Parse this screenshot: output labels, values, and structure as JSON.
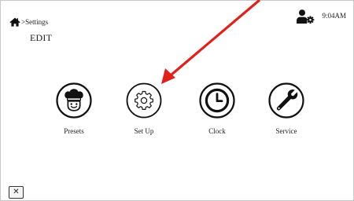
{
  "header": {
    "breadcrumb": ">Settings",
    "title": "EDIT",
    "time": "9:04AM"
  },
  "icons": {
    "home": "home-icon",
    "user_settings": "user-gear-icon",
    "close": "close-icon"
  },
  "menu": [
    {
      "id": "presets",
      "label": "Presets",
      "icon": "chef-icon"
    },
    {
      "id": "setup",
      "label": "Set Up",
      "icon": "gear-icon"
    },
    {
      "id": "clock",
      "label": "Clock",
      "icon": "clock-icon"
    },
    {
      "id": "service",
      "label": "Service",
      "icon": "wrench-icon"
    }
  ],
  "footer": {
    "close_label": "✕"
  },
  "colors": {
    "annotation_arrow": "#e0201b",
    "icon": "#111111"
  }
}
